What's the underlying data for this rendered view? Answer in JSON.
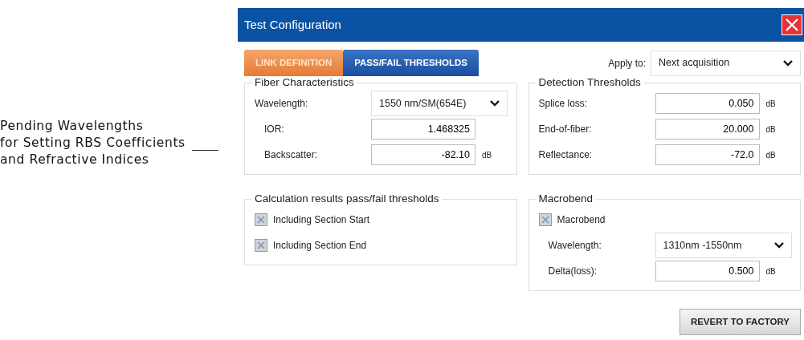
{
  "annotation": {
    "lines": [
      "Pending Wavelengths",
      "for Setting RBS Coefficients",
      "and Refractive Indices"
    ]
  },
  "window": {
    "title": "Test Configuration"
  },
  "tabs": [
    {
      "label": "LINK DEFINITION",
      "selected": true
    },
    {
      "label": "PASS/FAIL THRESHOLDS",
      "selected": false
    }
  ],
  "apply_to": {
    "label": "Apply to:",
    "value": "Next acquisition"
  },
  "left_groups": [
    {
      "title": "Fiber Characteristics",
      "rows": [
        {
          "kind": "select",
          "label": "Wavelength:",
          "value": "1550 nm/SM(654E)",
          "indented": false
        },
        {
          "kind": "input",
          "label": "IOR:",
          "value": "1.468325",
          "indented": true
        },
        {
          "kind": "input",
          "label": "Backscatter:",
          "value": "-82.10",
          "unit": "dB",
          "indented": true
        }
      ]
    },
    {
      "title": "Calculation results pass/fail thresholds",
      "rows": [
        {
          "kind": "checkbox",
          "label": "Including Section Start",
          "checked": true
        },
        {
          "kind": "checkbox",
          "label": "Including Section End",
          "checked": true
        }
      ]
    }
  ],
  "right_groups": [
    {
      "title": "Detection Thresholds",
      "rows": [
        {
          "kind": "input",
          "label": "Splice loss:",
          "value": "0.050",
          "unit": "dB",
          "indented": false
        },
        {
          "kind": "input",
          "label": "End-of-fiber:",
          "value": "20.000",
          "unit": "dB",
          "indented": false
        },
        {
          "kind": "input",
          "label": "Reflectance:",
          "value": "-72.0",
          "unit": "dB",
          "indented": false
        }
      ]
    },
    {
      "title": "Macrobend",
      "rows": [
        {
          "kind": "checkbox",
          "label": "Macrobend",
          "checked": true
        },
        {
          "kind": "select",
          "label": "Wavelength:",
          "value": "1310nm -1550nm",
          "indented": true
        },
        {
          "kind": "input",
          "label": "Delta(loss):",
          "value": "0.500",
          "unit": "dB",
          "indented": true
        }
      ]
    }
  ],
  "buttons": [
    "REVERT TO FACTORY"
  ]
}
